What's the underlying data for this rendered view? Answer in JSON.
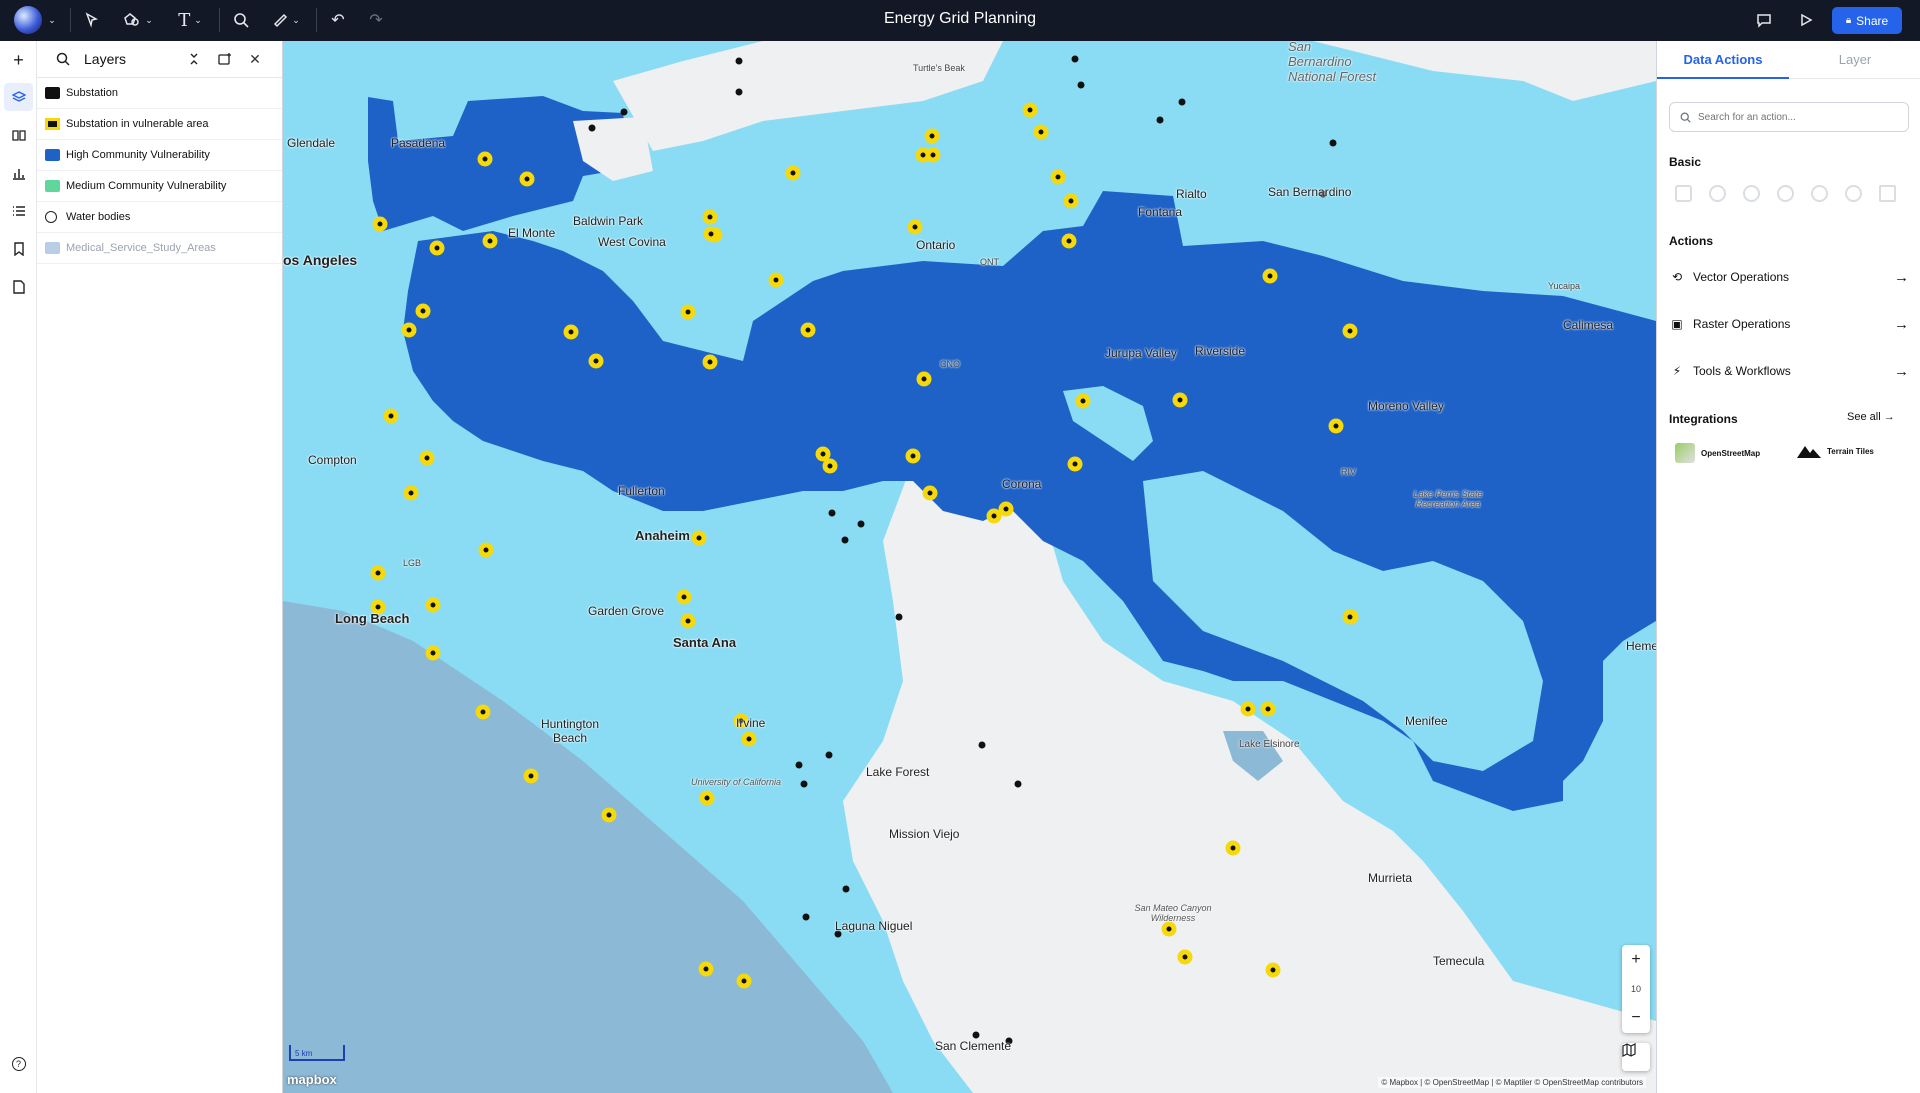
{
  "app": {
    "title": "Energy Grid Planning"
  },
  "topbar": {
    "share_label": "Share"
  },
  "layers_panel": {
    "title": "Layers",
    "layers": [
      {
        "label": "Substation",
        "color": "#111111"
      },
      {
        "label": "Substation in vulnerable area",
        "color": "#111111"
      },
      {
        "label": "High Community Vulnerability",
        "color": "#1e62c8"
      },
      {
        "label": "Medium Community Vulnerability",
        "color": "#5fd69a"
      },
      {
        "label": "Water bodies",
        "color": "#ffffff"
      },
      {
        "label": "Medical_Service_Study_Areas",
        "color": "#b9cde4"
      }
    ]
  },
  "map": {
    "labels": {
      "glendale": "Glendale",
      "pasadena": "Pasadena",
      "los_angeles": "os Angeles",
      "el_monte": "El Monte",
      "baldwin_park": "Baldwin Park",
      "west_covina": "West Covina",
      "ontario": "Ontario",
      "ont": "ONT",
      "cno": "CNO",
      "fontana": "Fontana",
      "rialto": "Rialto",
      "san_bernardino": "San Bernardino",
      "sb_forest": "San Bernardino National Forest",
      "turtles_beak": "Turtle's Beak",
      "yucaipa": "Yucaipa",
      "calimesa": "Calimesa",
      "jurupa_valley": "Jurupa Valley",
      "riverside": "Riverside",
      "moreno_valley": "Moreno Valley",
      "riv": "RIV",
      "lake_perris": "Lake Perris State Recreation Area",
      "compton": "Compton",
      "fullerton": "Fullerton",
      "anaheim": "Anaheim",
      "corona": "Corona",
      "lgb": "LGB",
      "long_beach": "Long Beach",
      "garden_grove": "Garden Grove",
      "santa_ana": "Santa Ana",
      "huntington_beach": "Huntington Beach",
      "irvine": "Irvine",
      "uc": "University of California",
      "lake_forest": "Lake Forest",
      "mission_viejo": "Mission Viejo",
      "laguna_niguel": "Laguna Niguel",
      "san_clemente": "San Clemente",
      "lake_elsinore": "Lake Elsinore",
      "menifee": "Menifee",
      "murrieta": "Murrieta",
      "temecula": "Temecula",
      "hemet": "Heme",
      "san_mateo": "San Mateo Canyon Wilderness"
    },
    "zoom_level": "10",
    "scale_label": "5 km",
    "logo": "mapbox",
    "attribution": "© Mapbox | © OpenStreetMap | © Maptiler © OpenStreetMap contributors"
  },
  "right_panel": {
    "tabs": [
      "Data Actions",
      "Layer"
    ],
    "search_placeholder": "Search for an action...",
    "basic_title": "Basic",
    "actions_title": "Actions",
    "actions": [
      "Vector Operations",
      "Raster Operations",
      "Tools & Workflows"
    ],
    "integrations_title": "Integrations",
    "see_all": "See all →",
    "integrations": [
      "OpenStreetMap",
      "Terrain Tiles"
    ]
  }
}
